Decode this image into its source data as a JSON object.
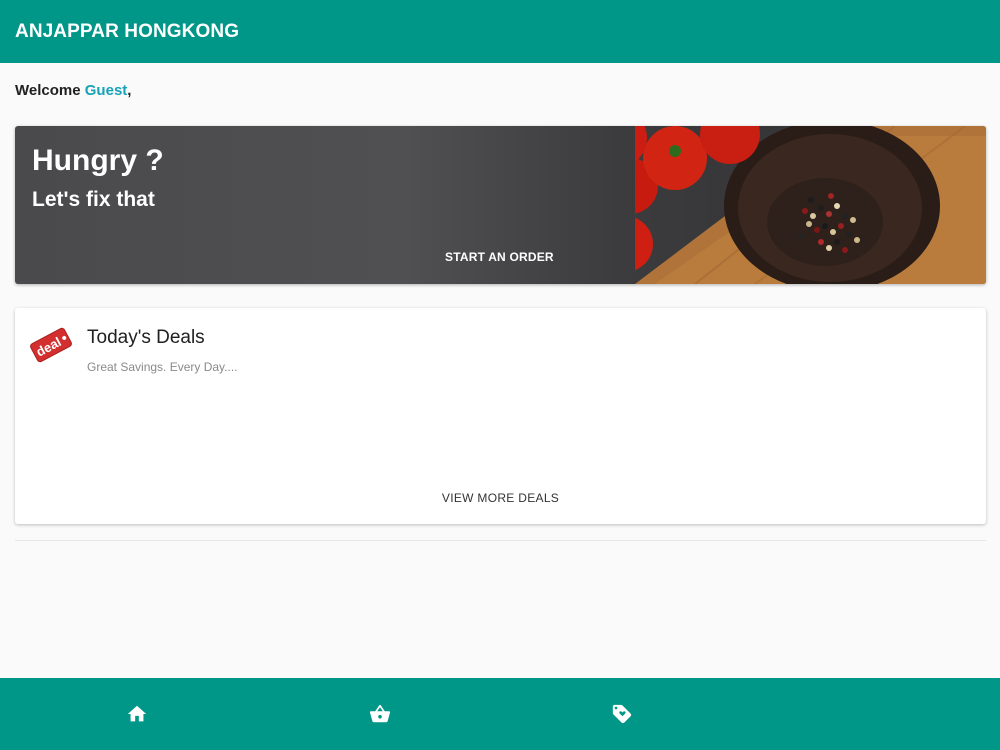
{
  "app": {
    "title": "ANJAPPAR HONGKONG"
  },
  "welcome": {
    "greeting": "Welcome",
    "user": "Guest",
    "punct": ","
  },
  "hero": {
    "title": "Hungry ?",
    "subtitle": "Let's fix that",
    "cta_label": "START AN ORDER"
  },
  "deals": {
    "badge_text": "deal",
    "title": "Today's Deals",
    "subtitle": "Great Savings. Every Day....",
    "more_label": "VIEW MORE DEALS"
  },
  "bottom_nav": {
    "items": [
      {
        "icon": "home-icon"
      },
      {
        "icon": "basket-icon"
      },
      {
        "icon": "tag-icon"
      }
    ]
  },
  "colors": {
    "primary": "#009688",
    "accent_guest": "#17a2b8",
    "deal_red": "#d32f2f"
  }
}
